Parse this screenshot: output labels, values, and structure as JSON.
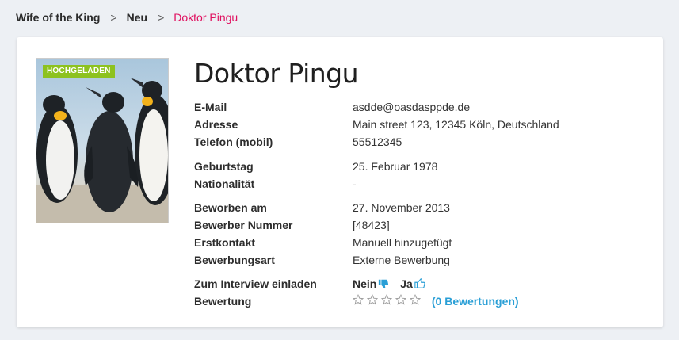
{
  "breadcrumb": {
    "items": [
      "Wife of the King",
      "Neu",
      "Doktor Pingu"
    ],
    "separator": ">"
  },
  "profile": {
    "badge": "HOCHGELADEN",
    "name": "Doktor Pingu",
    "fields": {
      "email": {
        "label": "E-Mail",
        "value": "asdde@oasdasppde.de"
      },
      "address": {
        "label": "Adresse",
        "value": "Main street 123, 12345 Köln, Deutschland"
      },
      "phone": {
        "label": "Telefon (mobil)",
        "value": "55512345"
      },
      "birthday": {
        "label": "Geburtstag",
        "value": "25. Februar 1978"
      },
      "nationality": {
        "label": "Nationalität",
        "value": "-"
      },
      "applied": {
        "label": "Beworben am",
        "value": "27. November 2013"
      },
      "applicant_number": {
        "label": "Bewerber Nummer",
        "value": "[48423]"
      },
      "first_contact": {
        "label": "Erstkontakt",
        "value": "Manuell hinzugefügt"
      },
      "application_type": {
        "label": "Bewerbungsart",
        "value": "Externe Bewerbung"
      },
      "interview": {
        "label": "Zum Interview einladen",
        "no": "Nein",
        "yes": "Ja"
      },
      "rating": {
        "label": "Bewertung",
        "stars": 0,
        "max_stars": 5,
        "link": "(0 Bewertungen)"
      }
    }
  },
  "colors": {
    "accent": "#e0105f",
    "link": "#2a9fd6",
    "badge": "#8dc21f",
    "background": "#edf0f4"
  },
  "icons": [
    "thumbs-down-icon",
    "thumbs-up-icon",
    "star-outline-icon"
  ]
}
